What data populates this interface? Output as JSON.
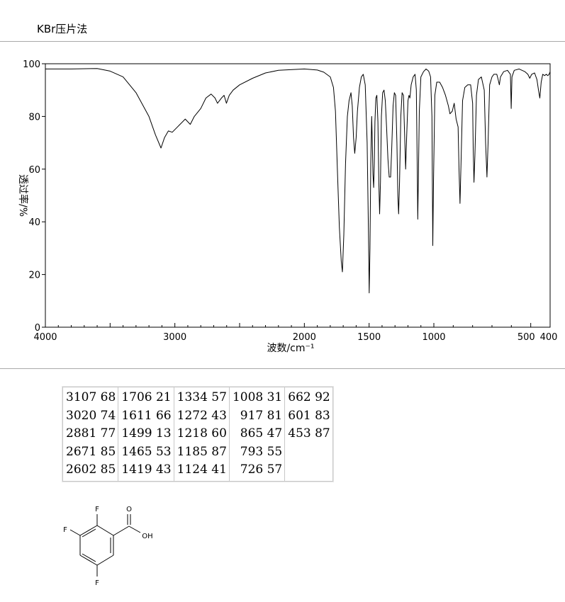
{
  "header": {
    "method": "KBr压片法"
  },
  "chart_data": {
    "type": "line",
    "title": "",
    "xlabel": "波数/cm⁻¹",
    "ylabel": "透过率/%",
    "xlim": [
      4000,
      400
    ],
    "ylim": [
      0,
      100
    ],
    "x_axis_scale": "piecewise linear: 4000–1000 and 1000–400 wavenumbers (x-axis reversed)",
    "x_ticks": [
      "4000",
      "3000",
      "2000",
      "1500",
      "1000",
      "500",
      "400"
    ],
    "y_ticks": [
      "0",
      "20",
      "40",
      "60",
      "80",
      "100"
    ],
    "grid": false,
    "series": [
      {
        "values": [
          [
            4000,
            98
          ],
          [
            3800,
            98
          ],
          [
            3600,
            98.2
          ],
          [
            3500,
            97.2
          ],
          [
            3400,
            95
          ],
          [
            3300,
            89
          ],
          [
            3200,
            80
          ],
          [
            3150,
            73
          ],
          [
            3107,
            68
          ],
          [
            3080,
            72
          ],
          [
            3050,
            74.5
          ],
          [
            3020,
            74
          ],
          [
            2980,
            76
          ],
          [
            2920,
            79
          ],
          [
            2881,
            77
          ],
          [
            2850,
            80
          ],
          [
            2800,
            83
          ],
          [
            2760,
            87
          ],
          [
            2720,
            88.5
          ],
          [
            2690,
            87
          ],
          [
            2671,
            85
          ],
          [
            2640,
            87
          ],
          [
            2620,
            88
          ],
          [
            2602,
            85
          ],
          [
            2580,
            88
          ],
          [
            2550,
            90
          ],
          [
            2500,
            92
          ],
          [
            2400,
            94.5
          ],
          [
            2300,
            96.5
          ],
          [
            2200,
            97.5
          ],
          [
            2000,
            98
          ],
          [
            1900,
            97.6
          ],
          [
            1850,
            96.8
          ],
          [
            1800,
            95
          ],
          [
            1775,
            91
          ],
          [
            1760,
            82
          ],
          [
            1745,
            60
          ],
          [
            1730,
            38
          ],
          [
            1715,
            25
          ],
          [
            1706,
            21
          ],
          [
            1695,
            35
          ],
          [
            1682,
            62
          ],
          [
            1668,
            80
          ],
          [
            1655,
            86
          ],
          [
            1640,
            89
          ],
          [
            1630,
            84
          ],
          [
            1620,
            72
          ],
          [
            1611,
            66
          ],
          [
            1600,
            72
          ],
          [
            1590,
            82
          ],
          [
            1575,
            91
          ],
          [
            1560,
            95
          ],
          [
            1545,
            96
          ],
          [
            1530,
            92
          ],
          [
            1515,
            70
          ],
          [
            1505,
            35
          ],
          [
            1499,
            13
          ],
          [
            1493,
            30
          ],
          [
            1487,
            62
          ],
          [
            1480,
            80
          ],
          [
            1475,
            70
          ],
          [
            1470,
            58
          ],
          [
            1465,
            53
          ],
          [
            1460,
            62
          ],
          [
            1455,
            78
          ],
          [
            1448,
            87
          ],
          [
            1440,
            88
          ],
          [
            1432,
            78
          ],
          [
            1425,
            55
          ],
          [
            1419,
            43
          ],
          [
            1412,
            55
          ],
          [
            1405,
            80
          ],
          [
            1395,
            89
          ],
          [
            1385,
            90
          ],
          [
            1375,
            86
          ],
          [
            1365,
            76
          ],
          [
            1355,
            64
          ],
          [
            1345,
            57
          ],
          [
            1334,
            57
          ],
          [
            1325,
            68
          ],
          [
            1315,
            84
          ],
          [
            1305,
            89
          ],
          [
            1295,
            88
          ],
          [
            1285,
            70
          ],
          [
            1278,
            50
          ],
          [
            1272,
            43
          ],
          [
            1265,
            55
          ],
          [
            1255,
            80
          ],
          [
            1245,
            89
          ],
          [
            1235,
            88
          ],
          [
            1225,
            72
          ],
          [
            1218,
            60
          ],
          [
            1210,
            72
          ],
          [
            1200,
            86
          ],
          [
            1192,
            88
          ],
          [
            1185,
            87
          ],
          [
            1175,
            92
          ],
          [
            1160,
            95
          ],
          [
            1145,
            96
          ],
          [
            1135,
            90
          ],
          [
            1128,
            60
          ],
          [
            1124,
            41
          ],
          [
            1120,
            55
          ],
          [
            1112,
            82
          ],
          [
            1100,
            95
          ],
          [
            1080,
            97
          ],
          [
            1060,
            98
          ],
          [
            1040,
            97.2
          ],
          [
            1025,
            95
          ],
          [
            1015,
            80
          ],
          [
            1008,
            31
          ],
          [
            1003,
            55
          ],
          [
            995,
            88
          ],
          [
            985,
            93
          ],
          [
            970,
            93
          ],
          [
            955,
            91
          ],
          [
            940,
            88
          ],
          [
            925,
            84
          ],
          [
            917,
            81
          ],
          [
            905,
            82
          ],
          [
            895,
            85
          ],
          [
            885,
            79
          ],
          [
            875,
            76
          ],
          [
            870,
            60
          ],
          [
            865,
            47
          ],
          [
            860,
            62
          ],
          [
            852,
            86
          ],
          [
            840,
            91
          ],
          [
            825,
            92
          ],
          [
            810,
            92
          ],
          [
            800,
            85
          ],
          [
            797,
            68
          ],
          [
            793,
            55
          ],
          [
            788,
            65
          ],
          [
            780,
            88
          ],
          [
            770,
            94
          ],
          [
            755,
            95
          ],
          [
            740,
            90
          ],
          [
            733,
            70
          ],
          [
            726,
            57
          ],
          [
            720,
            70
          ],
          [
            712,
            92
          ],
          [
            700,
            95
          ],
          [
            690,
            96
          ],
          [
            675,
            96
          ],
          [
            668,
            94
          ],
          [
            662,
            92
          ],
          [
            656,
            95
          ],
          [
            640,
            97
          ],
          [
            620,
            97.5
          ],
          [
            605,
            96
          ],
          [
            601,
            83
          ],
          [
            597,
            95
          ],
          [
            585,
            97.5
          ],
          [
            560,
            98
          ],
          [
            530,
            97
          ],
          [
            515,
            96
          ],
          [
            505,
            94.5
          ],
          [
            495,
            96
          ],
          [
            480,
            96.5
          ],
          [
            468,
            94
          ],
          [
            460,
            90
          ],
          [
            453,
            87
          ],
          [
            446,
            93
          ],
          [
            438,
            96
          ],
          [
            428,
            95.5
          ],
          [
            420,
            96
          ],
          [
            412,
            95.5
          ],
          [
            405,
            96
          ],
          [
            400,
            97
          ]
        ]
      }
    ],
    "peak_table": [
      [
        "3107",
        "68"
      ],
      [
        "3020",
        "74"
      ],
      [
        "2881",
        "77"
      ],
      [
        "2671",
        "85"
      ],
      [
        "2602",
        "85"
      ],
      [
        "1706",
        "21"
      ],
      [
        "1611",
        "66"
      ],
      [
        "1499",
        "13"
      ],
      [
        "1465",
        "53"
      ],
      [
        "1419",
        "43"
      ],
      [
        "1334",
        "57"
      ],
      [
        "1272",
        "43"
      ],
      [
        "1218",
        "60"
      ],
      [
        "1185",
        "87"
      ],
      [
        "1124",
        "41"
      ],
      [
        "1008",
        "31"
      ],
      [
        "917",
        "81"
      ],
      [
        "865",
        "47"
      ],
      [
        "793",
        "55"
      ],
      [
        "726",
        "57"
      ],
      [
        "662",
        "92"
      ],
      [
        "601",
        "83"
      ],
      [
        "453",
        "87"
      ]
    ]
  },
  "peaks_table": {
    "columns": [
      [
        "3107 68",
        "3020 74",
        "2881 77",
        "2671 85",
        "2602 85"
      ],
      [
        "1706 21",
        "1611 66",
        "1499 13",
        "1465 53",
        "1419 43"
      ],
      [
        "1334 57",
        "1272 43",
        "1218 60",
        "1185 87",
        "1124 41"
      ],
      [
        "1008 31",
        "  917 81",
        "  865 47",
        "  793 55",
        "  726 57"
      ],
      [
        "662 92",
        "601 83",
        "453 87"
      ]
    ]
  },
  "molecule": {
    "atom_labels": [
      "F",
      "F",
      "F",
      "O",
      "OH"
    ]
  }
}
